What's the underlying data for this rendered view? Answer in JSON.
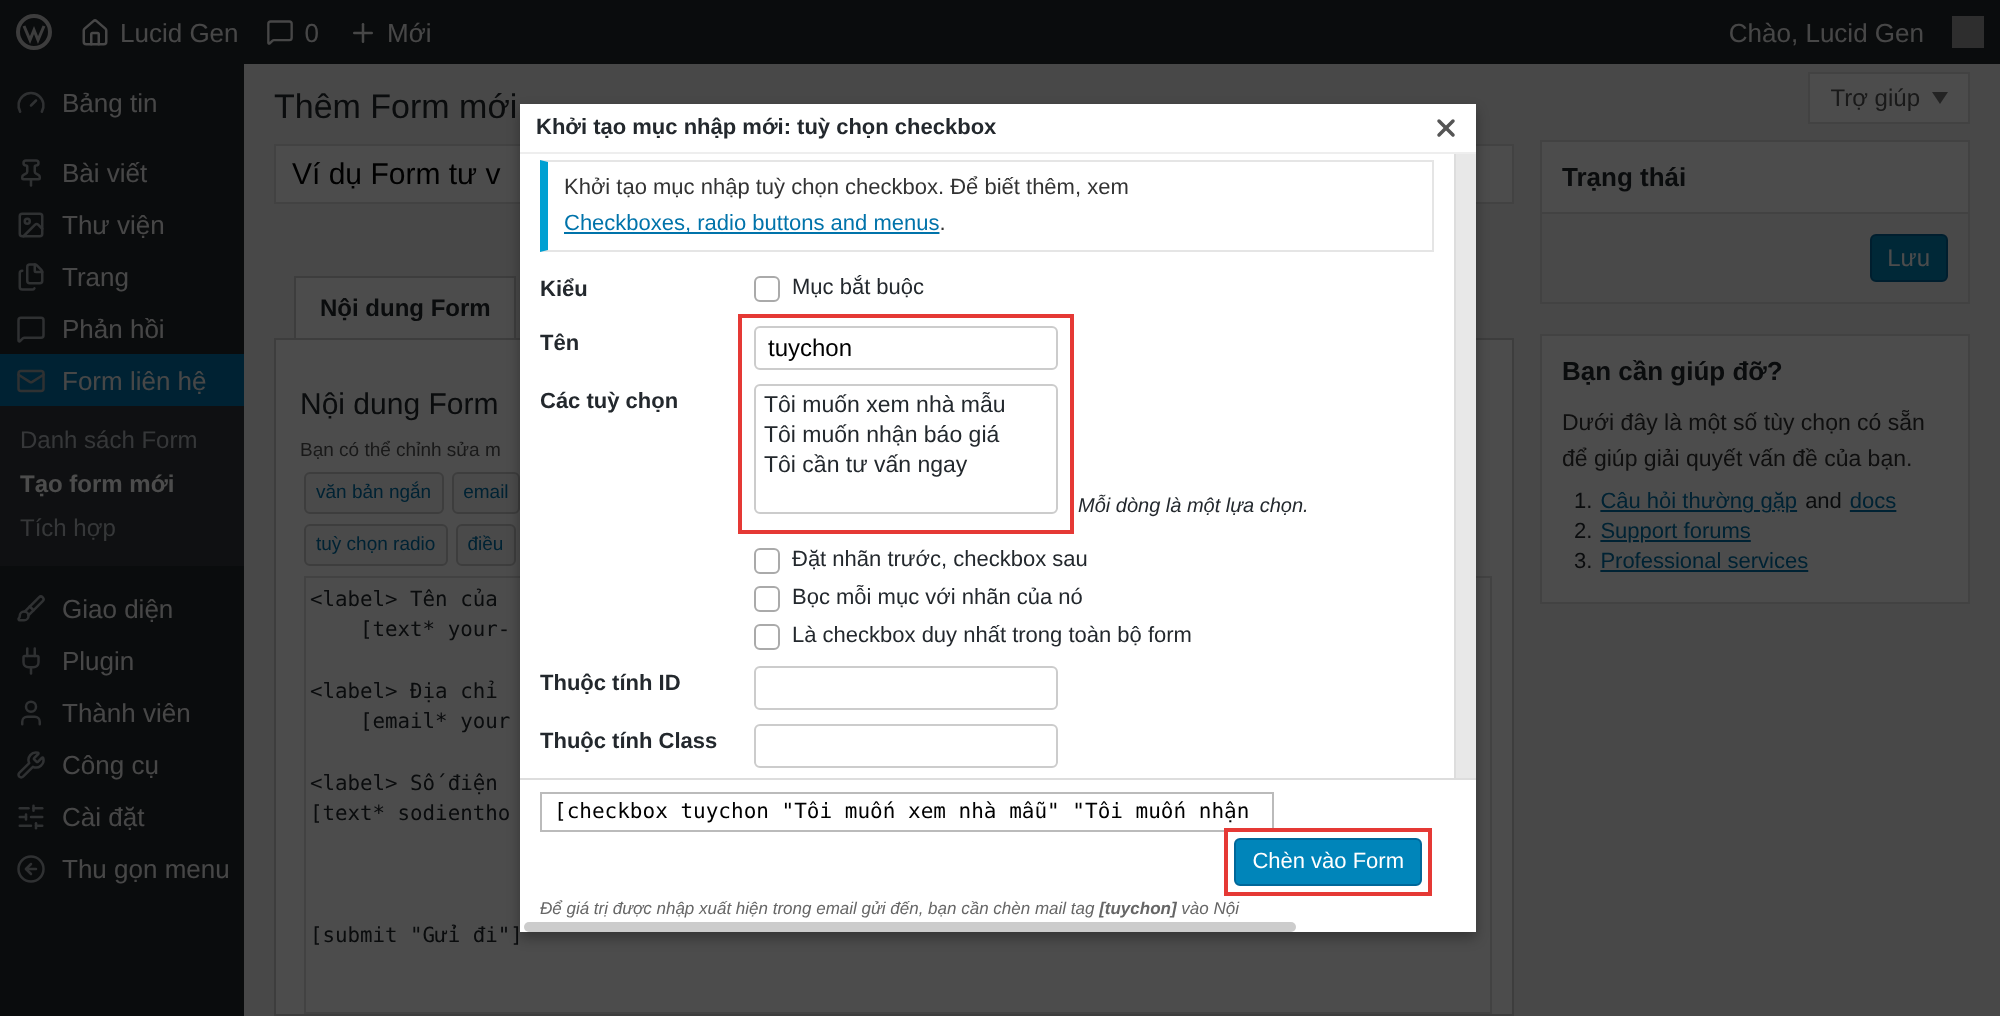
{
  "admin_bar": {
    "site": "Lucid Gen",
    "comments": "0",
    "new": "Mới",
    "greeting": "Chào, Lucid Gen"
  },
  "sidebar": {
    "items": [
      {
        "label": "Bảng tin",
        "selected": false
      },
      {
        "label": "Bài viết",
        "selected": false
      },
      {
        "label": "Thư viện",
        "selected": false
      },
      {
        "label": "Trang",
        "selected": false
      },
      {
        "label": "Phản hồi",
        "selected": false
      },
      {
        "label": "Form liên hệ",
        "selected": true,
        "children": [
          {
            "label": "Danh sách Form",
            "selected": false
          },
          {
            "label": "Tạo form mới",
            "selected": true
          },
          {
            "label": "Tích hợp",
            "selected": false
          }
        ]
      },
      {
        "label": "Giao diện",
        "selected": false
      },
      {
        "label": "Plugin",
        "selected": false
      },
      {
        "label": "Thành viên",
        "selected": false
      },
      {
        "label": "Công cụ",
        "selected": false
      },
      {
        "label": "Cài đặt",
        "selected": false
      }
    ],
    "collapse": "Thu gọn menu"
  },
  "help_button": "Trợ giúp",
  "page_title": "Thêm Form mới",
  "form_title_value": "Ví dụ Form tư v",
  "tabs": [
    {
      "label": "Nội dung Form",
      "selected": true
    }
  ],
  "editor": {
    "heading": "Nội dung Form",
    "description": "Bạn có thể chỉnh sửa m",
    "tag_button_rows": [
      [
        "văn bản ngắn",
        "email"
      ],
      [
        "tuỳ chọn radio",
        "điều"
      ]
    ],
    "code_blocks": [
      [
        "<label> Tên của",
        "    [text* your-"
      ],
      [
        "<label> Địa chỉ",
        "    [email* your"
      ],
      [
        "<label> Số điện",
        "[text* sodientho"
      ],
      [
        "[submit \"Gửi đi\"]"
      ]
    ]
  },
  "status_box": {
    "title": "Trạng thái",
    "save": "Lưu"
  },
  "help_box": {
    "title": "Bạn cần giúp đỡ?",
    "text": "Dưới đây là một số tùy chọn có sẵn để giúp giải quyết vấn đề của bạn.",
    "items": [
      {
        "number": "1.",
        "parts": [
          {
            "text": "Câu hỏi thường gặp",
            "link": true
          },
          {
            "text": "and",
            "link": false
          },
          {
            "text": "docs",
            "link": true
          }
        ]
      },
      {
        "number": "2.",
        "parts": [
          {
            "text": "Support forums",
            "link": true
          }
        ]
      },
      {
        "number": "3.",
        "parts": [
          {
            "text": "Professional services",
            "link": true
          }
        ]
      }
    ]
  },
  "modal": {
    "title": "Khởi tạo mục nhập mới: tuỳ chọn checkbox",
    "notice": {
      "text": "Khởi tạo mục nhập tuỳ chọn checkbox. Để biết thêm, xem",
      "link": "Checkboxes, radio buttons and menus",
      "end": "."
    },
    "sections": [
      {
        "fields": [
          {
            "kind": "checkboxes",
            "label": "Kiểu",
            "options": [
              {
                "label": "Mục bắt buộc",
                "checked": false
              }
            ]
          }
        ]
      },
      {
        "highlighted": true,
        "fields": [
          {
            "kind": "text",
            "label": "Tên",
            "value": "tuychon"
          },
          {
            "kind": "textarea",
            "label": "Các tuỳ chọn",
            "lines": [
              "Tôi muốn xem nhà mẫu",
              "Tôi muốn nhận báo giá",
              "Tôi cần tư vấn ngay"
            ],
            "note": "Mỗi dòng là một lựa chọn."
          }
        ]
      },
      {
        "fields": [
          {
            "kind": "checkboxes",
            "options": [
              {
                "label": "Đặt nhãn trước, checkbox sau",
                "checked": false
              },
              {
                "label": "Bọc mỗi mục với nhãn của nó",
                "checked": false
              },
              {
                "label": "Là checkbox duy nhất trong toàn bộ form",
                "checked": false
              }
            ]
          },
          {
            "kind": "text",
            "label": "Thuộc tính ID"
          },
          {
            "kind": "text",
            "label": "Thuộc tính Class"
          }
        ]
      }
    ],
    "tag": "[checkbox tuychon \"Tôi muốn xem nhà mẫu\" \"Tôi muốn nhận",
    "insert_button": {
      "label": "Chèn vào Form",
      "highlighted": true
    },
    "footer_note": "Để giá trị được nhập xuất hiện trong email gửi đến, bạn cần chèn mail tag **[tuychon]** vào Nội"
  }
}
